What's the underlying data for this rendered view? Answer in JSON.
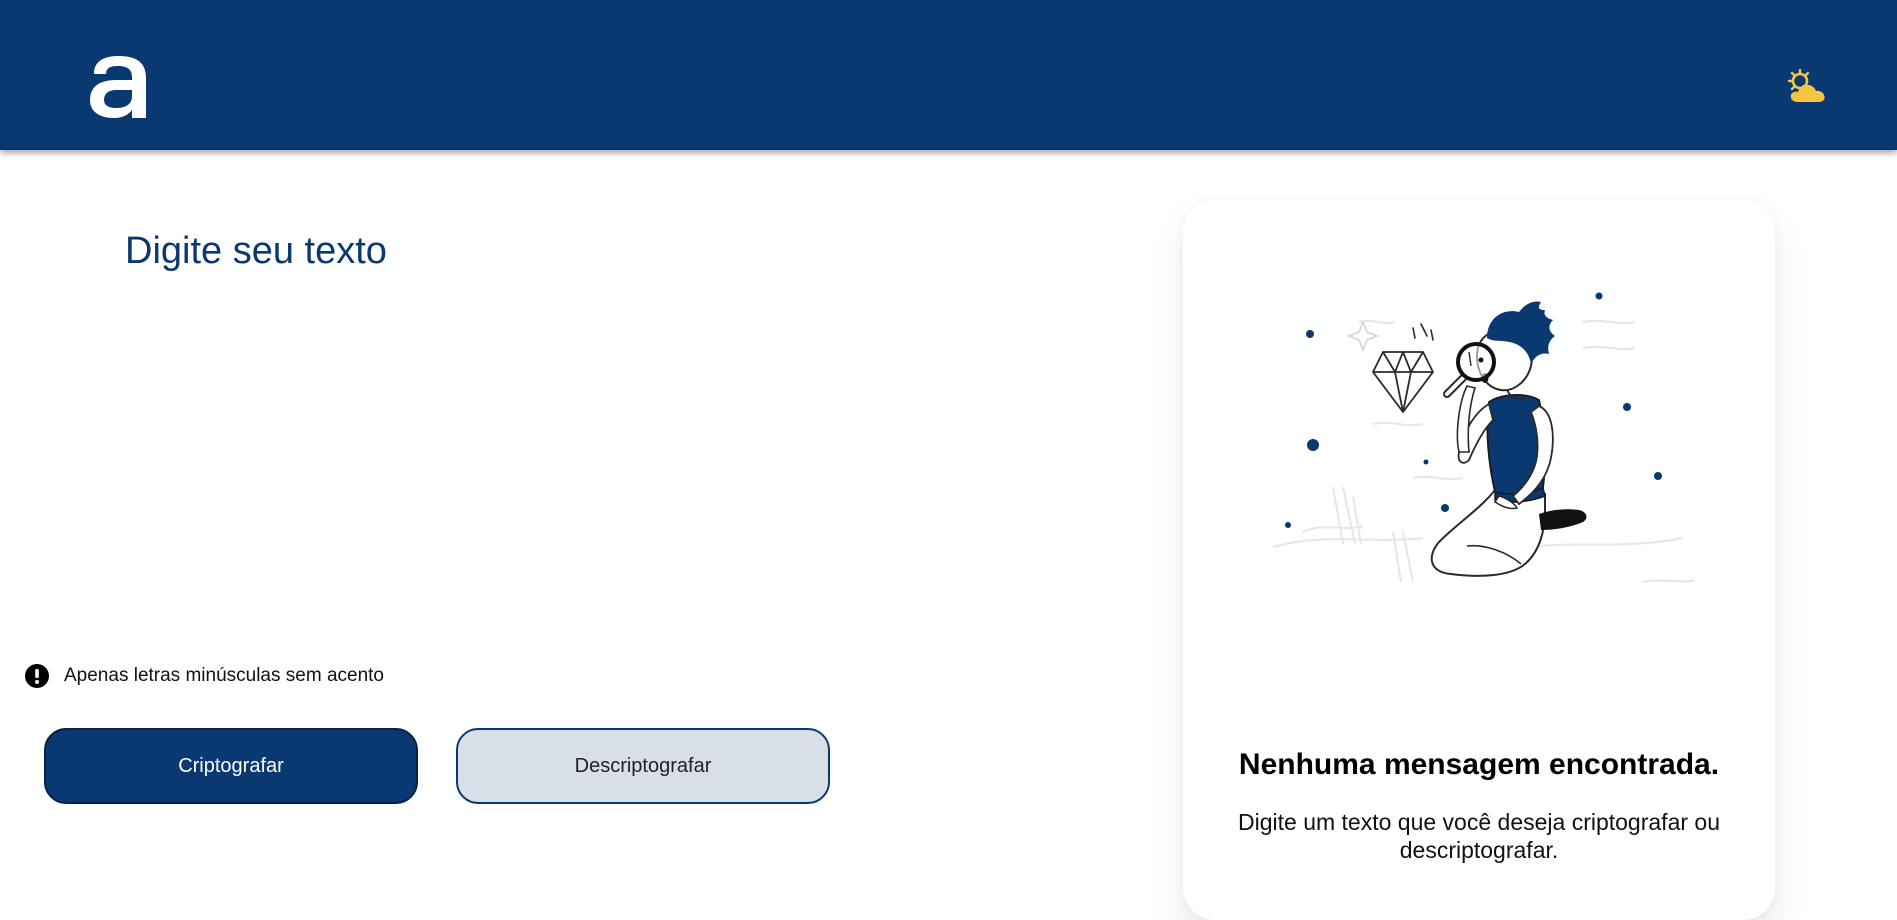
{
  "header": {
    "logo_icon": "alura-a-logo",
    "theme_icon": "sun-cloud-icon",
    "background_color": "#0a3871",
    "theme_icon_color": "#f4c542"
  },
  "input": {
    "placeholder": "Digite seu texto",
    "value": ""
  },
  "hint": {
    "icon": "exclamation-circle-icon",
    "text": "Apenas letras minúsculas sem acento"
  },
  "buttons": {
    "encrypt_label": "Criptografar",
    "decrypt_label": "Descriptografar"
  },
  "output": {
    "illustration": "person-with-magnifying-glass-illustration",
    "title": "Nenhuma mensagem encontrada.",
    "text": "Digite um texto que você deseja criptografar ou descriptografar."
  },
  "colors": {
    "primary": "#0a3871",
    "secondary_button": "#d8dfe8"
  }
}
